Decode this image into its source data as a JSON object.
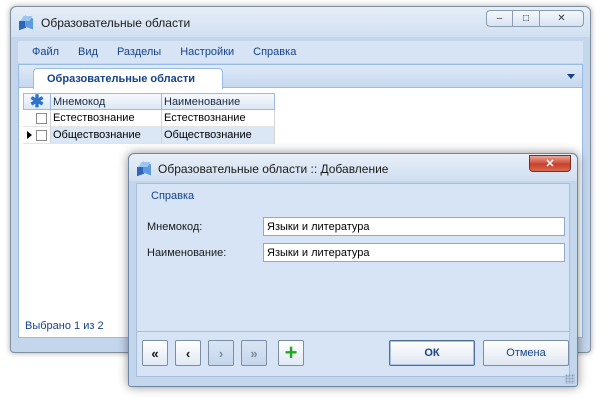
{
  "main_window": {
    "title": "Образовательные области",
    "caption_buttons": {
      "minimize": "–",
      "maximize": "□",
      "close": "✕"
    }
  },
  "menu": {
    "items": [
      "Файл",
      "Вид",
      "Разделы",
      "Настройки",
      "Справка"
    ]
  },
  "tab": {
    "label": "Образовательные области"
  },
  "grid": {
    "header_icon": "asterisk-icon",
    "columns": [
      "Мнемокод",
      "Наименование"
    ],
    "rows": [
      {
        "mnemocode": "Естествознание",
        "name": "Естествознание",
        "selected": false
      },
      {
        "mnemocode": "Обществознание",
        "name": "Обществознание",
        "selected": true
      }
    ]
  },
  "status": {
    "text": "Выбрано 1 из 2"
  },
  "dialog": {
    "title": "Образовательные области :: Добавление",
    "menu_item": "Справка",
    "fields": {
      "mnemocode_label": "Мнемокод:",
      "mnemocode_value": "Языки и литература",
      "name_label": "Наименование:",
      "name_value": "Языки и литература"
    },
    "nav": {
      "first": "«",
      "prev": "‹",
      "next": "›",
      "last": "»",
      "add": "+"
    },
    "ok_label": "ОК",
    "cancel_label": "Отмена"
  },
  "colors": {
    "accent": "#15428b",
    "frame": "#c4d6ec",
    "selected_row": "#dce7f6",
    "add_green": "#22a81f",
    "close_red": "#c9412a"
  }
}
